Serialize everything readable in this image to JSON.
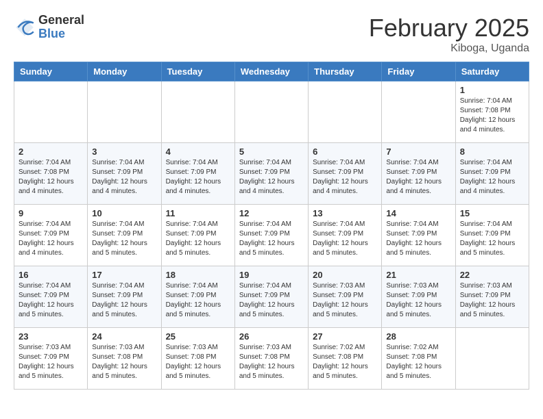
{
  "header": {
    "logo_general": "General",
    "logo_blue": "Blue",
    "month_title": "February 2025",
    "location": "Kiboga, Uganda"
  },
  "days_of_week": [
    "Sunday",
    "Monday",
    "Tuesday",
    "Wednesday",
    "Thursday",
    "Friday",
    "Saturday"
  ],
  "weeks": [
    [
      {
        "day": "",
        "info": ""
      },
      {
        "day": "",
        "info": ""
      },
      {
        "day": "",
        "info": ""
      },
      {
        "day": "",
        "info": ""
      },
      {
        "day": "",
        "info": ""
      },
      {
        "day": "",
        "info": ""
      },
      {
        "day": "1",
        "info": "Sunrise: 7:04 AM\nSunset: 7:08 PM\nDaylight: 12 hours\nand 4 minutes."
      }
    ],
    [
      {
        "day": "2",
        "info": "Sunrise: 7:04 AM\nSunset: 7:08 PM\nDaylight: 12 hours\nand 4 minutes."
      },
      {
        "day": "3",
        "info": "Sunrise: 7:04 AM\nSunset: 7:09 PM\nDaylight: 12 hours\nand 4 minutes."
      },
      {
        "day": "4",
        "info": "Sunrise: 7:04 AM\nSunset: 7:09 PM\nDaylight: 12 hours\nand 4 minutes."
      },
      {
        "day": "5",
        "info": "Sunrise: 7:04 AM\nSunset: 7:09 PM\nDaylight: 12 hours\nand 4 minutes."
      },
      {
        "day": "6",
        "info": "Sunrise: 7:04 AM\nSunset: 7:09 PM\nDaylight: 12 hours\nand 4 minutes."
      },
      {
        "day": "7",
        "info": "Sunrise: 7:04 AM\nSunset: 7:09 PM\nDaylight: 12 hours\nand 4 minutes."
      },
      {
        "day": "8",
        "info": "Sunrise: 7:04 AM\nSunset: 7:09 PM\nDaylight: 12 hours\nand 4 minutes."
      }
    ],
    [
      {
        "day": "9",
        "info": "Sunrise: 7:04 AM\nSunset: 7:09 PM\nDaylight: 12 hours\nand 4 minutes."
      },
      {
        "day": "10",
        "info": "Sunrise: 7:04 AM\nSunset: 7:09 PM\nDaylight: 12 hours\nand 5 minutes."
      },
      {
        "day": "11",
        "info": "Sunrise: 7:04 AM\nSunset: 7:09 PM\nDaylight: 12 hours\nand 5 minutes."
      },
      {
        "day": "12",
        "info": "Sunrise: 7:04 AM\nSunset: 7:09 PM\nDaylight: 12 hours\nand 5 minutes."
      },
      {
        "day": "13",
        "info": "Sunrise: 7:04 AM\nSunset: 7:09 PM\nDaylight: 12 hours\nand 5 minutes."
      },
      {
        "day": "14",
        "info": "Sunrise: 7:04 AM\nSunset: 7:09 PM\nDaylight: 12 hours\nand 5 minutes."
      },
      {
        "day": "15",
        "info": "Sunrise: 7:04 AM\nSunset: 7:09 PM\nDaylight: 12 hours\nand 5 minutes."
      }
    ],
    [
      {
        "day": "16",
        "info": "Sunrise: 7:04 AM\nSunset: 7:09 PM\nDaylight: 12 hours\nand 5 minutes."
      },
      {
        "day": "17",
        "info": "Sunrise: 7:04 AM\nSunset: 7:09 PM\nDaylight: 12 hours\nand 5 minutes."
      },
      {
        "day": "18",
        "info": "Sunrise: 7:04 AM\nSunset: 7:09 PM\nDaylight: 12 hours\nand 5 minutes."
      },
      {
        "day": "19",
        "info": "Sunrise: 7:04 AM\nSunset: 7:09 PM\nDaylight: 12 hours\nand 5 minutes."
      },
      {
        "day": "20",
        "info": "Sunrise: 7:03 AM\nSunset: 7:09 PM\nDaylight: 12 hours\nand 5 minutes."
      },
      {
        "day": "21",
        "info": "Sunrise: 7:03 AM\nSunset: 7:09 PM\nDaylight: 12 hours\nand 5 minutes."
      },
      {
        "day": "22",
        "info": "Sunrise: 7:03 AM\nSunset: 7:09 PM\nDaylight: 12 hours\nand 5 minutes."
      }
    ],
    [
      {
        "day": "23",
        "info": "Sunrise: 7:03 AM\nSunset: 7:09 PM\nDaylight: 12 hours\nand 5 minutes."
      },
      {
        "day": "24",
        "info": "Sunrise: 7:03 AM\nSunset: 7:08 PM\nDaylight: 12 hours\nand 5 minutes."
      },
      {
        "day": "25",
        "info": "Sunrise: 7:03 AM\nSunset: 7:08 PM\nDaylight: 12 hours\nand 5 minutes."
      },
      {
        "day": "26",
        "info": "Sunrise: 7:03 AM\nSunset: 7:08 PM\nDaylight: 12 hours\nand 5 minutes."
      },
      {
        "day": "27",
        "info": "Sunrise: 7:02 AM\nSunset: 7:08 PM\nDaylight: 12 hours\nand 5 minutes."
      },
      {
        "day": "28",
        "info": "Sunrise: 7:02 AM\nSunset: 7:08 PM\nDaylight: 12 hours\nand 5 minutes."
      },
      {
        "day": "",
        "info": ""
      }
    ]
  ]
}
